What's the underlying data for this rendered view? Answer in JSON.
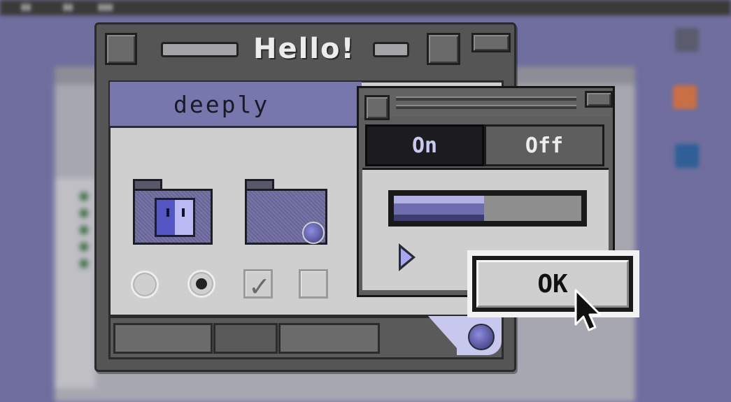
{
  "window": {
    "title": "Hello!"
  },
  "tab": {
    "label": "deeply"
  },
  "controls": {
    "radio_unselected": false,
    "radio_selected": true,
    "checkbox_checked": true,
    "checkbox_unchecked": false
  },
  "segmented": {
    "on_label": "On",
    "off_label": "Off",
    "selected": "On"
  },
  "progress": {
    "value_fraction": 0.48
  },
  "dialog": {
    "ok_label": "OK"
  },
  "icons": [
    "finder-folder-icon",
    "generic-folder-icon",
    "disclosure-triangle-icon",
    "arrow-cursor-icon"
  ],
  "colors": {
    "accent": "#7776ad",
    "window_frame": "#555556",
    "panel": "#cfcfd0",
    "desktop": "#6f6e9e"
  }
}
